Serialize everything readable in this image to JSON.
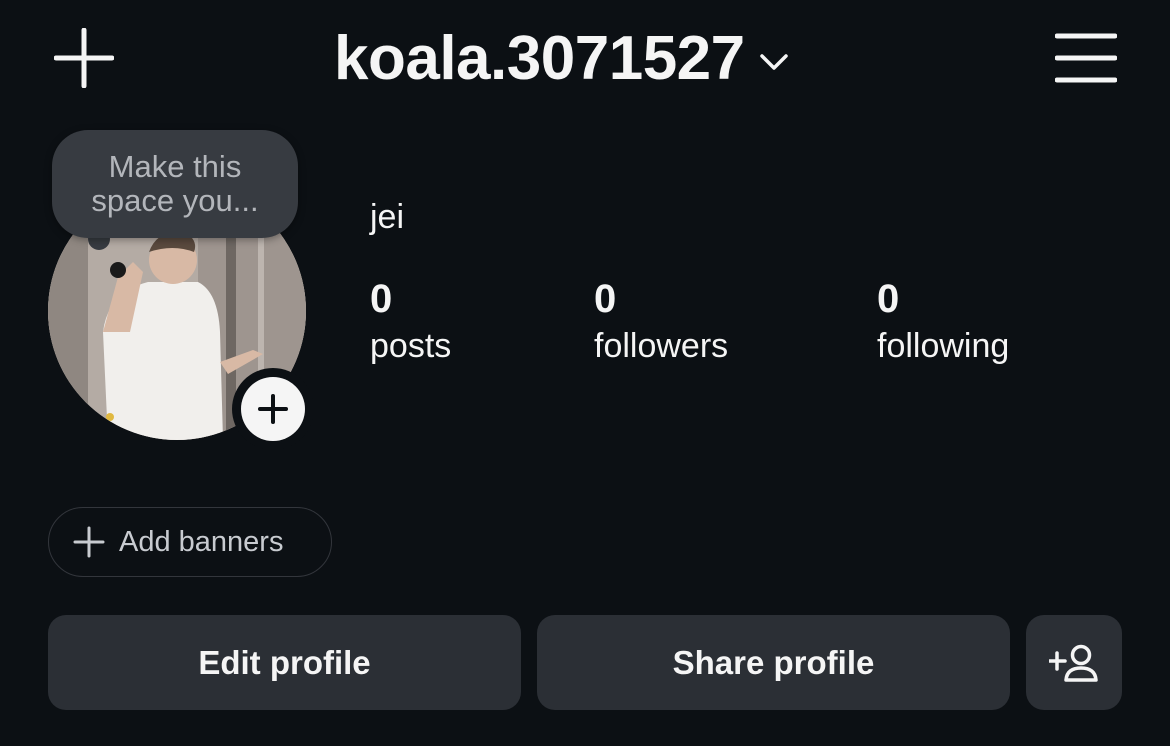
{
  "header": {
    "new_icon": "plus-icon",
    "username": "koala.3071527",
    "switch_icon": "chevron-down-icon",
    "menu_icon": "hamburger-menu-icon"
  },
  "note": {
    "text": "Make this space you..."
  },
  "profile": {
    "display_name": "jei",
    "add_story_icon": "plus-icon"
  },
  "stats": [
    {
      "value": "0",
      "label": "posts"
    },
    {
      "value": "0",
      "label": "followers"
    },
    {
      "value": "0",
      "label": "following"
    }
  ],
  "banners": {
    "label": "Add banners"
  },
  "actions": {
    "edit_label": "Edit profile",
    "share_label": "Share profile",
    "suggest_icon": "add-person-icon"
  },
  "colors": {
    "background": "#0c1014",
    "button": "#2b2f35",
    "text": "#f5f5f5"
  }
}
